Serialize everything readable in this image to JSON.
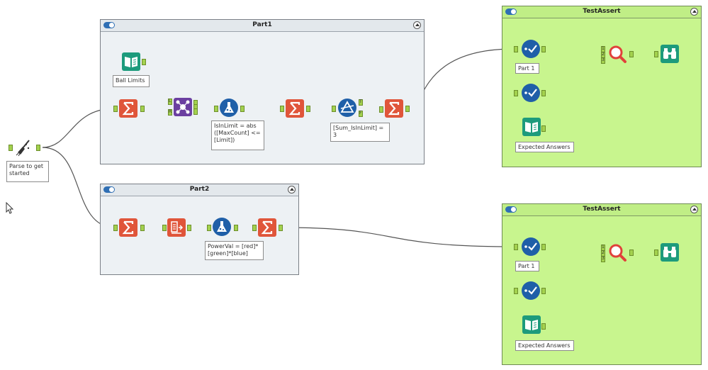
{
  "containers": {
    "part1": {
      "title": "Part1"
    },
    "part2": {
      "title": "Part2"
    },
    "test_assert_1": {
      "title": "TestAssert"
    },
    "test_assert_2": {
      "title": "TestAssert"
    }
  },
  "annotations": {
    "parse": "Parse to get\nstarted",
    "ball_limits": "Ball Limits",
    "is_in_limit": "IsInLimit = abs\n([MaxCount] <=\n[Limit])",
    "sum_is_in_limit": "[Sum_IsInLimit] =\n3",
    "power_val": "PowerVal = [red]*\n[green]*[blue]",
    "assert1_part": "Part 1",
    "assert1_expected": "Expected Answers",
    "assert2_part": "Part 1",
    "assert2_expected": "Expected Answers"
  },
  "anchor_labels": {
    "join_left": "L",
    "join_right": "R",
    "filter_true": "T",
    "filter_false": "F",
    "assert_input_1": "1",
    "assert_input_2": "2",
    "assert_input_3": "3"
  },
  "colors": {
    "summarize": "#e0553a",
    "formula": "#1f5fa8",
    "filter": "#1f5fa8",
    "join": "#6b3fa0",
    "input_book": "#1d9b7c",
    "browse": "#1d9b7c",
    "container_green": "#c8f58e",
    "container_gray": "#edf1f4"
  },
  "icons": {
    "parse": "broom-icon",
    "book": "book-input-icon",
    "summarize": "sigma-summarize-icon",
    "join": "join-icon",
    "formula": "flask-formula-icon",
    "filter": "filter-icon",
    "assert": "checkmark-assert-icon",
    "compare": "magnifier-compare-icon",
    "browse": "binoculars-browse-icon",
    "select": "select-icon",
    "cursor": "mouse-pointer-icon"
  }
}
